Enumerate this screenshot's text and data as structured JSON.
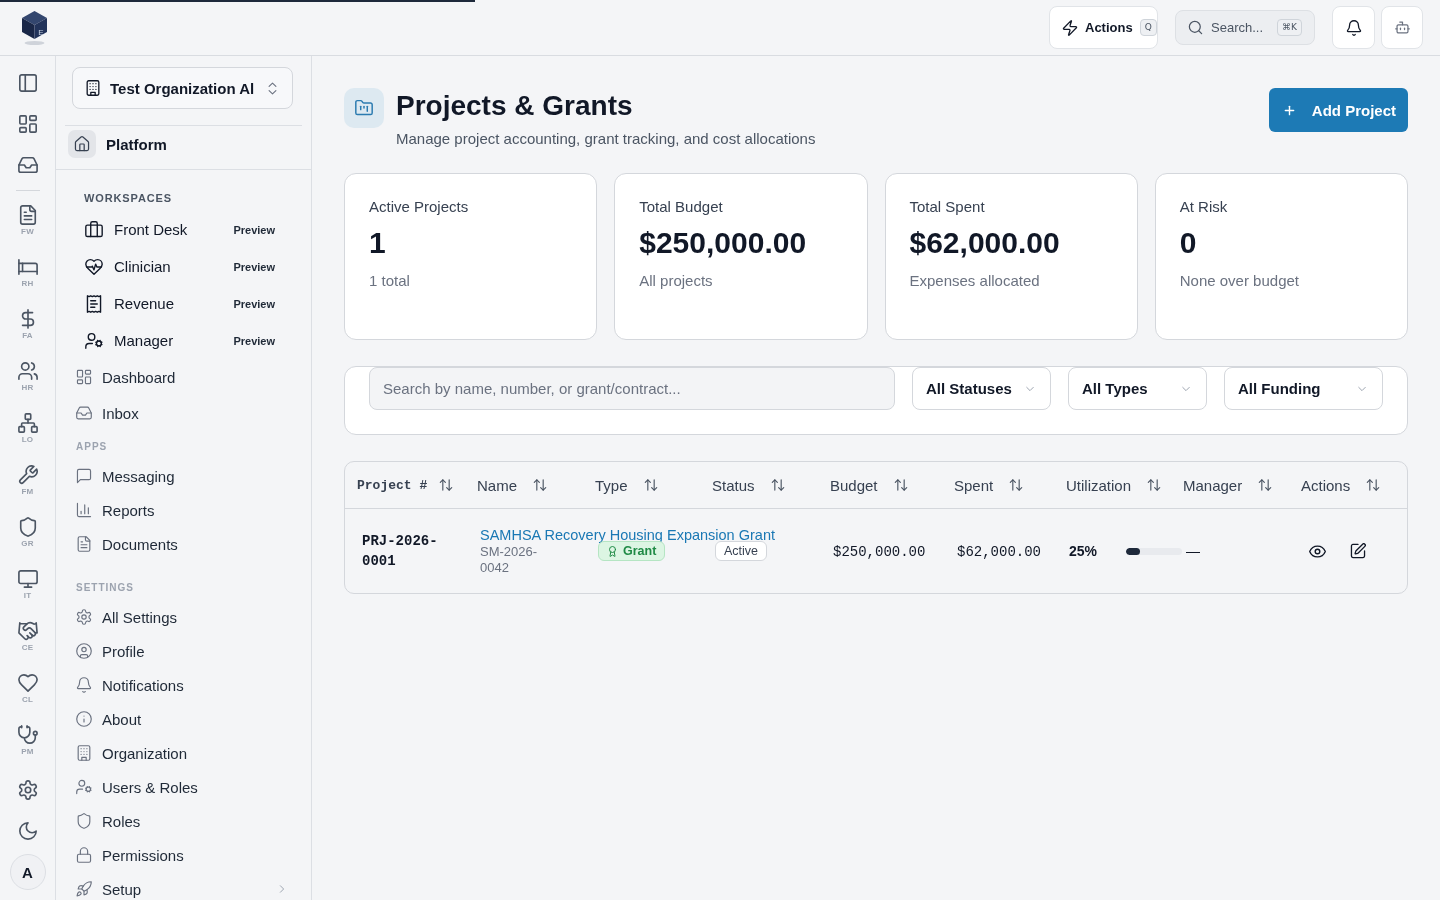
{
  "loading_bar": {
    "level": 0.33
  },
  "topbar": {
    "logo_letter": "E",
    "actions": {
      "label": "Actions",
      "shortcut": "Q"
    },
    "search": {
      "label": "Search...",
      "shortcut": "⌘K"
    }
  },
  "rail": {
    "modules": [
      "FW",
      "RH",
      "FA",
      "HR",
      "LO",
      "FM",
      "GR",
      "IT",
      "CE",
      "CL",
      "PM"
    ],
    "avatar": "A"
  },
  "sidebar": {
    "organization": "Test Organization Al",
    "platform": "Platform",
    "workspaces": {
      "title": "WORKSPACES",
      "items": [
        {
          "label": "Front Desk",
          "badge": "Preview"
        },
        {
          "label": "Clinician",
          "badge": "Preview"
        },
        {
          "label": "Revenue",
          "badge": "Preview"
        },
        {
          "label": "Manager",
          "badge": "Preview"
        }
      ]
    },
    "groups": [
      {
        "items": [
          {
            "label": "Dashboard",
            "kind": "link"
          },
          {
            "label": "Inbox",
            "kind": "link"
          }
        ]
      },
      {
        "title": "APPS",
        "items": [
          {
            "label": "Messaging",
            "kind": "link"
          },
          {
            "label": "Reports",
            "kind": "link"
          },
          {
            "label": "Documents",
            "kind": "link"
          }
        ]
      },
      {
        "title": "SETTINGS",
        "items": [
          {
            "label": "All Settings",
            "kind": "link"
          },
          {
            "label": "Profile",
            "kind": "link"
          },
          {
            "label": "Notifications",
            "kind": "link"
          },
          {
            "label": "About",
            "kind": "link"
          },
          {
            "label": "Organization",
            "kind": "link"
          },
          {
            "label": "Users & Roles",
            "kind": "link"
          },
          {
            "label": "Roles",
            "kind": "link"
          },
          {
            "label": "Permissions",
            "kind": "link"
          },
          {
            "label": "Setup",
            "kind": "group"
          }
        ]
      }
    ]
  },
  "page": {
    "title": "Projects & Grants",
    "subtitle": "Manage project accounting, grant tracking, and cost allocations",
    "add_button": "Add Project"
  },
  "stats": [
    {
      "label": "Active Projects",
      "value": "1",
      "note": "1 total"
    },
    {
      "label": "Total Budget",
      "value": "$250,000.00",
      "note": "All projects"
    },
    {
      "label": "Total Spent",
      "value": "$62,000.00",
      "note": "Expenses allocated"
    },
    {
      "label": "At Risk",
      "value": "0",
      "note": "None over budget"
    }
  ],
  "filters": {
    "search": {
      "placeholder": "Search by name, number, or grant/contract..."
    },
    "selects": [
      "All Statuses",
      "All Types",
      "All Funding"
    ]
  },
  "table": {
    "columns": [
      "Project #",
      "Name",
      "Type",
      "Status",
      "Budget",
      "Spent",
      "Utilization",
      "Manager",
      "Actions"
    ],
    "rows": [
      {
        "number": "PRJ-2026-0001",
        "name": "SAMHSA Recovery Housing Expansion Grant",
        "code": "SM-2026-0042",
        "type": "Grant",
        "status": "Active",
        "budget": "$250,000.00",
        "spent": "$62,000.00",
        "utilization": "25%",
        "level": 0.25,
        "manager": "—"
      }
    ]
  }
}
